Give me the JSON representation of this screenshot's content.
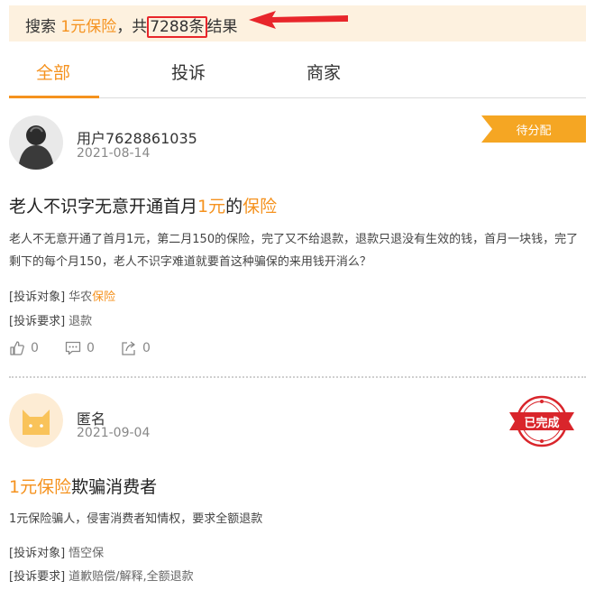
{
  "search": {
    "prefix": "搜索 ",
    "keyword": "1元保险",
    "mid": "，共",
    "count": "7288",
    "unit": "条",
    "suffix": "结果"
  },
  "tabs": [
    {
      "label": "全部",
      "active": true
    },
    {
      "label": "投诉",
      "active": false
    },
    {
      "label": "商家",
      "active": false
    }
  ],
  "complaints": [
    {
      "user": "用户7628861035",
      "date": "2021-08-14",
      "status": "待分配",
      "title_parts": [
        "老人不识字无意开通首月",
        "1元",
        "的",
        "保险"
      ],
      "body": "老人不无意开通了首月1元，第二月150的保险，完了又不给退款，退款只退没有生效的钱，首月一块钱，完了剩下的每个月150，老人不识字难道就要首这种骗保的来用钱开消么？",
      "target_label": "[投诉对象]",
      "target_parts": [
        "华农",
        "保险"
      ],
      "request_label": "[投诉要求]",
      "request": "退款",
      "likes": "0",
      "comments": "0",
      "shares": "0"
    },
    {
      "user": "匿名",
      "date": "2021-09-04",
      "status": "已完成",
      "title_parts": [
        "1元保险",
        "欺骗消费者"
      ],
      "body": "1元保险骗人，侵害消费者知情权，要求全额退款",
      "target_label": "[投诉对象]",
      "target": "悟空保",
      "request_label": "[投诉要求]",
      "request": "道歉赔偿/解释,全额退款"
    }
  ],
  "colors": {
    "accent": "#f5921e",
    "banner_bg": "#fdf1df",
    "highlight_box": "#e8262b",
    "status_pending": "#f5a623",
    "status_done": "#d9252b"
  }
}
